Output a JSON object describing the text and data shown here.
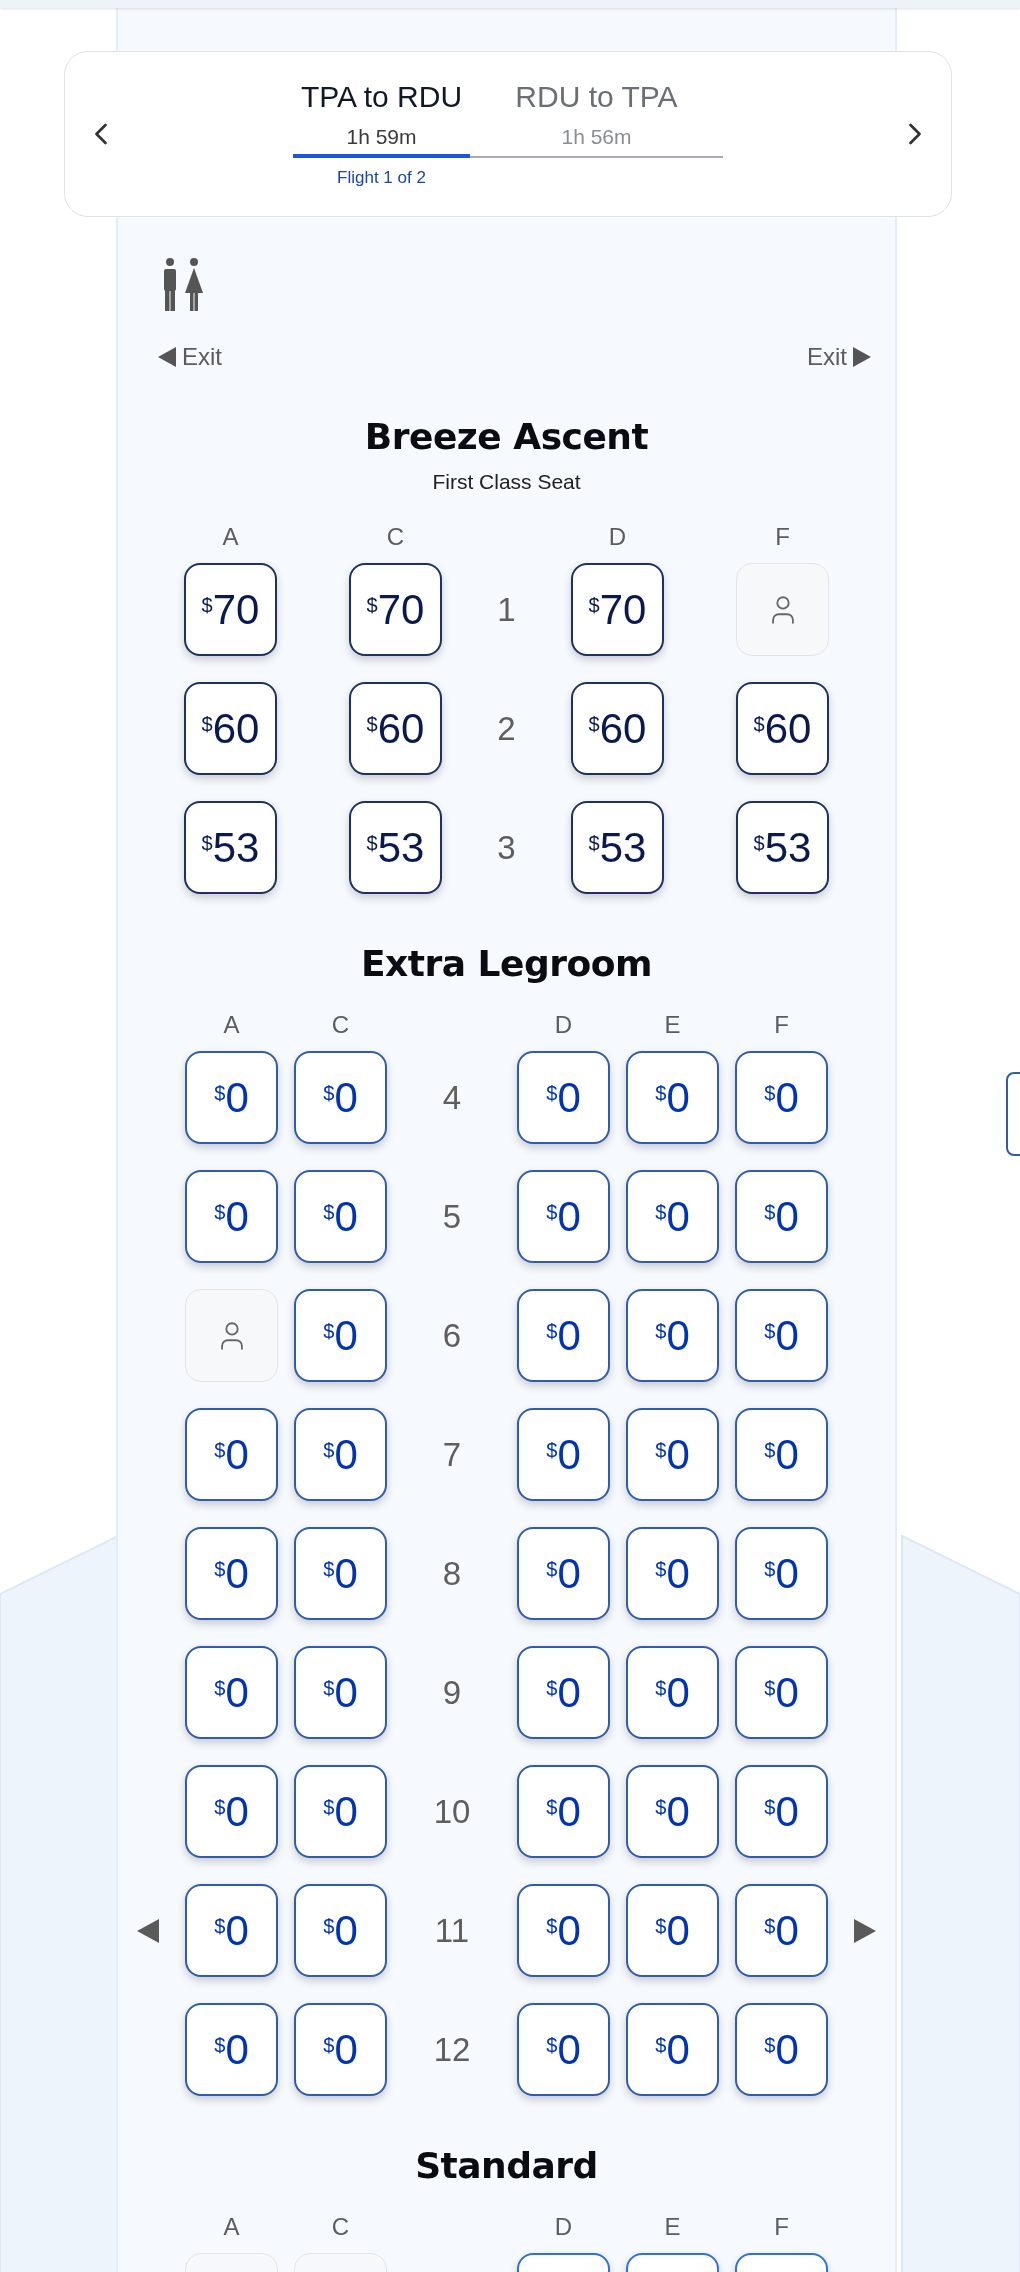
{
  "trip_nav": {
    "tabs": [
      {
        "route": "TPA to RDU",
        "duration": "1h 59m",
        "selected": true
      },
      {
        "route": "RDU to TPA",
        "duration": "1h 56m",
        "selected": false
      }
    ],
    "flight_indicator": "Flight 1 of 2"
  },
  "exits": {
    "left": "Exit",
    "right": "Exit"
  },
  "sections": [
    {
      "kind": "first",
      "title": "Breeze Ascent",
      "subtitle": "First Class Seat",
      "columns": [
        "A",
        "C",
        "D",
        "F"
      ],
      "rows": [
        {
          "number": "1",
          "exit_row": false,
          "seats": [
            {
              "kind": "available",
              "currency": "$",
              "price": "70"
            },
            {
              "kind": "available",
              "currency": "$",
              "price": "70"
            },
            {
              "kind": "available",
              "currency": "$",
              "price": "70"
            },
            {
              "kind": "occupied"
            }
          ]
        },
        {
          "number": "2",
          "exit_row": false,
          "seats": [
            {
              "kind": "available",
              "currency": "$",
              "price": "60"
            },
            {
              "kind": "available",
              "currency": "$",
              "price": "60"
            },
            {
              "kind": "available",
              "currency": "$",
              "price": "60"
            },
            {
              "kind": "available",
              "currency": "$",
              "price": "60"
            }
          ]
        },
        {
          "number": "3",
          "exit_row": false,
          "seats": [
            {
              "kind": "available",
              "currency": "$",
              "price": "53"
            },
            {
              "kind": "available",
              "currency": "$",
              "price": "53"
            },
            {
              "kind": "available",
              "currency": "$",
              "price": "53"
            },
            {
              "kind": "available",
              "currency": "$",
              "price": "53"
            }
          ]
        }
      ]
    },
    {
      "kind": "legroom",
      "title": "Extra Legroom",
      "columns": [
        "A",
        "C",
        "D",
        "E",
        "F"
      ],
      "rows": [
        {
          "number": "4",
          "exit_row": false,
          "seats": [
            {
              "kind": "available",
              "currency": "$",
              "price": "0"
            },
            {
              "kind": "available",
              "currency": "$",
              "price": "0"
            },
            {
              "kind": "available",
              "currency": "$",
              "price": "0"
            },
            {
              "kind": "available",
              "currency": "$",
              "price": "0"
            },
            {
              "kind": "available",
              "currency": "$",
              "price": "0"
            }
          ]
        },
        {
          "number": "5",
          "exit_row": false,
          "seats": [
            {
              "kind": "available",
              "currency": "$",
              "price": "0"
            },
            {
              "kind": "available",
              "currency": "$",
              "price": "0"
            },
            {
              "kind": "available",
              "currency": "$",
              "price": "0"
            },
            {
              "kind": "available",
              "currency": "$",
              "price": "0"
            },
            {
              "kind": "available",
              "currency": "$",
              "price": "0"
            }
          ]
        },
        {
          "number": "6",
          "exit_row": false,
          "seats": [
            {
              "kind": "occupied"
            },
            {
              "kind": "available",
              "currency": "$",
              "price": "0"
            },
            {
              "kind": "available",
              "currency": "$",
              "price": "0"
            },
            {
              "kind": "available",
              "currency": "$",
              "price": "0"
            },
            {
              "kind": "available",
              "currency": "$",
              "price": "0"
            }
          ]
        },
        {
          "number": "7",
          "exit_row": false,
          "seats": [
            {
              "kind": "available",
              "currency": "$",
              "price": "0"
            },
            {
              "kind": "available",
              "currency": "$",
              "price": "0"
            },
            {
              "kind": "available",
              "currency": "$",
              "price": "0"
            },
            {
              "kind": "available",
              "currency": "$",
              "price": "0"
            },
            {
              "kind": "available",
              "currency": "$",
              "price": "0"
            }
          ]
        },
        {
          "number": "8",
          "exit_row": false,
          "seats": [
            {
              "kind": "available",
              "currency": "$",
              "price": "0"
            },
            {
              "kind": "available",
              "currency": "$",
              "price": "0"
            },
            {
              "kind": "available",
              "currency": "$",
              "price": "0"
            },
            {
              "kind": "available",
              "currency": "$",
              "price": "0"
            },
            {
              "kind": "available",
              "currency": "$",
              "price": "0"
            }
          ]
        },
        {
          "number": "9",
          "exit_row": false,
          "seats": [
            {
              "kind": "available",
              "currency": "$",
              "price": "0"
            },
            {
              "kind": "available",
              "currency": "$",
              "price": "0"
            },
            {
              "kind": "available",
              "currency": "$",
              "price": "0"
            },
            {
              "kind": "available",
              "currency": "$",
              "price": "0"
            },
            {
              "kind": "available",
              "currency": "$",
              "price": "0"
            }
          ]
        },
        {
          "number": "10",
          "exit_row": false,
          "seats": [
            {
              "kind": "available",
              "currency": "$",
              "price": "0"
            },
            {
              "kind": "available",
              "currency": "$",
              "price": "0"
            },
            {
              "kind": "available",
              "currency": "$",
              "price": "0"
            },
            {
              "kind": "available",
              "currency": "$",
              "price": "0"
            },
            {
              "kind": "available",
              "currency": "$",
              "price": "0"
            }
          ]
        },
        {
          "number": "11",
          "exit_row": true,
          "seats": [
            {
              "kind": "available",
              "currency": "$",
              "price": "0"
            },
            {
              "kind": "available",
              "currency": "$",
              "price": "0"
            },
            {
              "kind": "available",
              "currency": "$",
              "price": "0"
            },
            {
              "kind": "available",
              "currency": "$",
              "price": "0"
            },
            {
              "kind": "available",
              "currency": "$",
              "price": "0"
            }
          ]
        },
        {
          "number": "12",
          "exit_row": false,
          "seats": [
            {
              "kind": "available",
              "currency": "$",
              "price": "0"
            },
            {
              "kind": "available",
              "currency": "$",
              "price": "0"
            },
            {
              "kind": "available",
              "currency": "$",
              "price": "0"
            },
            {
              "kind": "available",
              "currency": "$",
              "price": "0"
            },
            {
              "kind": "available",
              "currency": "$",
              "price": "0"
            }
          ]
        }
      ]
    },
    {
      "kind": "standard",
      "title": "Standard",
      "columns": [
        "A",
        "C",
        "D",
        "E",
        "F"
      ],
      "rows": [
        {
          "seats": [
            {
              "kind": "unavailable"
            },
            {
              "kind": "unavailable"
            },
            {
              "kind": "available"
            },
            {
              "kind": "available"
            },
            {
              "kind": "available"
            }
          ]
        }
      ]
    }
  ]
}
